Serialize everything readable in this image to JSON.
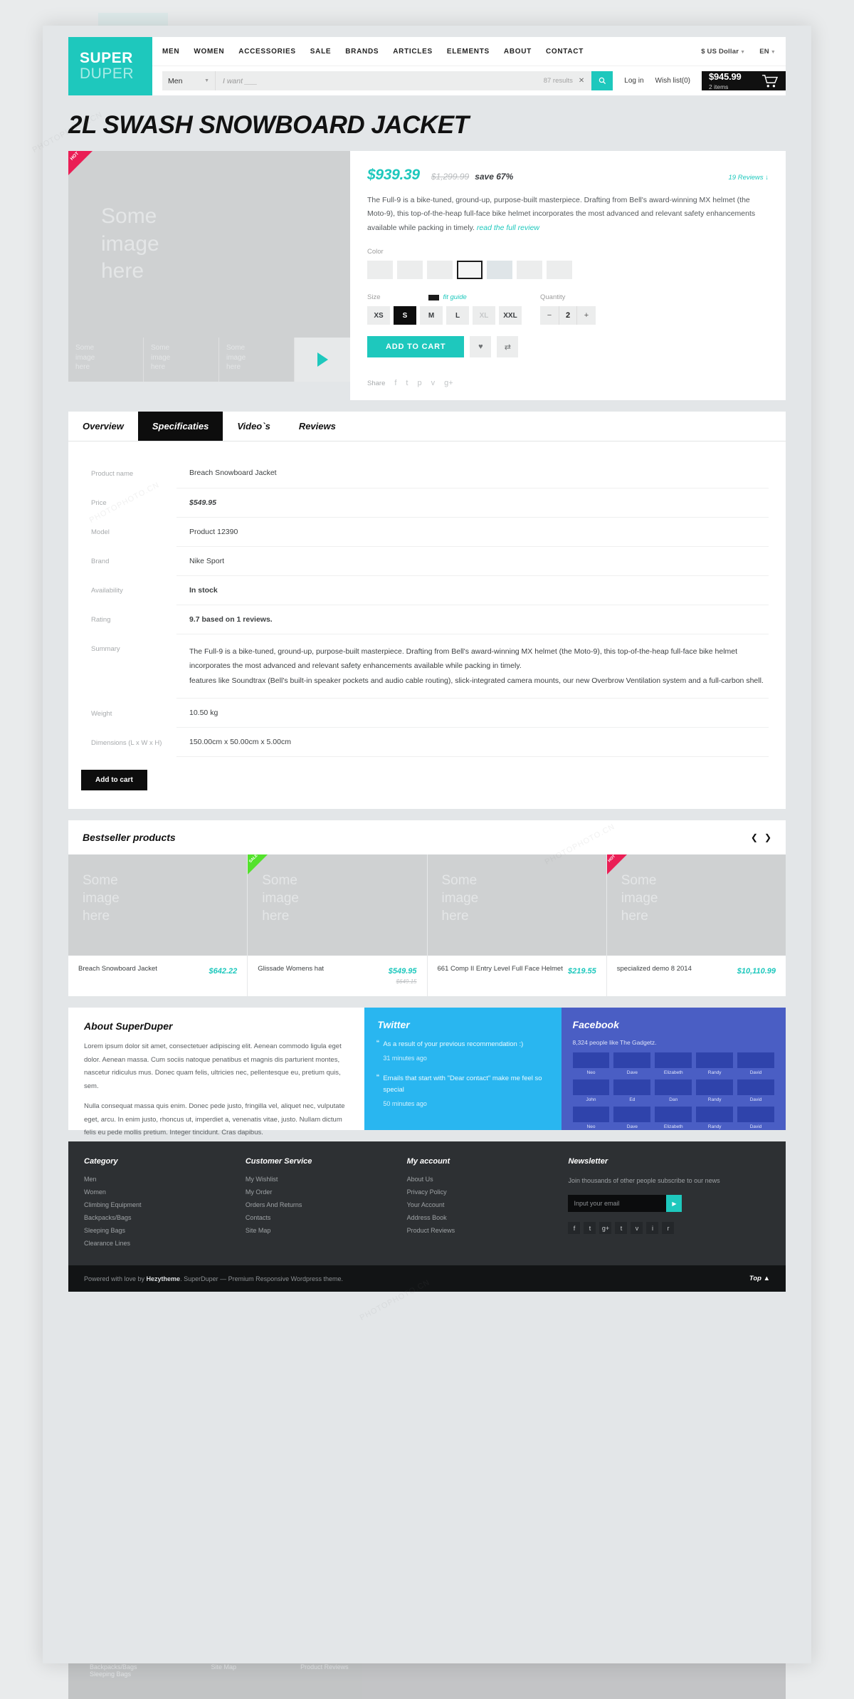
{
  "header": {
    "logo_line1": "SUPER",
    "logo_line2": "DUPER",
    "nav": [
      "MEN",
      "WOMEN",
      "ACCESSORIES",
      "SALE",
      "BRANDS",
      "ARTICLES",
      "ELEMENTS",
      "ABOUT",
      "CONTACT"
    ],
    "currency": "$ US Dollar",
    "language": "EN",
    "category_select": "Men",
    "search_placeholder": "I want ___",
    "search_results": "87 results",
    "search_clear": "✕",
    "search_icon": "search-icon",
    "login": "Log in",
    "wishlist": "Wish list(0)",
    "cart_amount": "$945.99",
    "cart_items": "2 items"
  },
  "product": {
    "title": "2L SWASH SNOWBOARD JACKET",
    "ribbon": "HOT",
    "image_placeholder": "Some image here",
    "thumb_placeholder": "Some image here",
    "price": "$939.39",
    "old_price": "$1,299.99",
    "save": "save 67%",
    "reviews_link": "19 Reviews ↓",
    "description": "The Full-9 is a bike-tuned, ground-up, purpose-built masterpiece. Drafting from Bell's award-winning MX helmet (the Moto-9), this top-of-the-heap full-face bike helmet incorporates the most advanced and relevant safety enhancements available while packing in timely.",
    "read_full_review": "read the full review",
    "color_label": "Color",
    "size_label": "Size",
    "fit_guide": "fit guide",
    "quantity_label": "Quantity",
    "sizes": [
      {
        "label": "XS",
        "state": "normal"
      },
      {
        "label": "S",
        "state": "active"
      },
      {
        "label": "M",
        "state": "normal"
      },
      {
        "label": "L",
        "state": "normal"
      },
      {
        "label": "XL",
        "state": "disabled"
      },
      {
        "label": "XXL",
        "state": "normal"
      }
    ],
    "qty_minus": "−",
    "qty_value": "2",
    "qty_plus": "+",
    "add_to_cart": "ADD TO CART",
    "wishlist_icon": "♥",
    "compare_icon": "⇄",
    "share_label": "Share",
    "share_icons": [
      "f",
      "t",
      "p",
      "v",
      "g+"
    ]
  },
  "tabs": [
    {
      "label": "Overview",
      "active": false
    },
    {
      "label": "Specificaties",
      "active": true
    },
    {
      "label": "Video`s",
      "active": false
    },
    {
      "label": "Reviews",
      "active": false
    }
  ],
  "spec": {
    "rows": [
      {
        "key": "Product name",
        "value": "Breach Snowboard Jacket",
        "style": "plain"
      },
      {
        "key": "Price",
        "value": "$549.95",
        "style": "teal"
      },
      {
        "key": "Model",
        "value": "Product 12390",
        "style": "plain"
      },
      {
        "key": "Brand",
        "value": "Nike Sport",
        "style": "plain"
      },
      {
        "key": "Availability",
        "value": "In stock",
        "style": "teal"
      },
      {
        "key": "Rating",
        "value": "9.7   based on 1 reviews.",
        "style": "rating"
      },
      {
        "key": "Summary",
        "value": "The Full-9 is a bike-tuned, ground-up, purpose-built masterpiece. Drafting from Bell's award-winning MX helmet (the Moto-9), this top-of-the-heap full-face bike helmet incorporates the most advanced and relevant safety enhancements available while packing in timely.\n features like Soundtrax (Bell's built-in speaker pockets and audio cable routing), slick-integrated camera mounts, our new Overbrow Ventilation system and a full-carbon shell.",
        "style": "summary"
      },
      {
        "key": "Weight",
        "value": "10.50 kg",
        "style": "plain"
      },
      {
        "key": "Dimensions (L x W x H)",
        "value": "150.00cm x 50.00cm x 5.00cm",
        "style": "plain"
      }
    ],
    "add_to_cart": "Add to cart"
  },
  "bestseller": {
    "title": "Bestseller products",
    "prev": "❮",
    "next": "❯",
    "image_placeholder": "Some image here",
    "items": [
      {
        "name": "Breach Snowboard Jacket",
        "price": "$642.22",
        "old_price": "",
        "badge": ""
      },
      {
        "name": "Glissade Womens hat",
        "price": "$549.95",
        "old_price": "$649.15",
        "badge": "SALE"
      },
      {
        "name": "661 Comp II Entry Level Full Face Helmet",
        "price": "$219.55",
        "old_price": "",
        "badge": ""
      },
      {
        "name": "specialized demo 8 2014",
        "price": "$10,110.99",
        "old_price": "",
        "badge": "HOT"
      }
    ]
  },
  "about": {
    "title": "About SuperDuper",
    "paragraph1": "Lorem ipsum dolor sit amet, consectetuer adipiscing elit. Aenean commodo ligula eget dolor. Aenean massa. Cum sociis natoque penatibus et magnis dis parturient montes, nascetur ridiculus mus. Donec quam felis, ultricies nec, pellentesque eu, pretium quis, sem.",
    "paragraph2": "Nulla consequat massa quis enim. Donec pede justo, fringilla vel, aliquet nec, vulputate eget, arcu. In enim justo, rhoncus ut, imperdiet a, venenatis vitae, justo. Nullam dictum felis eu pede mollis pretium. Integer tincidunt. Cras dapibus."
  },
  "twitter": {
    "title": "Twitter",
    "tweets": [
      {
        "text": "As a result of your previous recommendation :)",
        "time": "31 minutes ago"
      },
      {
        "text": "Emails that start with \"Dear contact\" make me feel so special",
        "time": "50 minutes ago"
      }
    ]
  },
  "facebook": {
    "title": "Facebook",
    "likes": "8,324 people like The Gadgetz.",
    "friends": [
      "Neo",
      "Dave",
      "Elizabeth",
      "Randy",
      "David",
      "John",
      "Ed",
      "Dan",
      "Randy",
      "David",
      "Neo",
      "Dave",
      "Elizabeth",
      "Randy",
      "David"
    ]
  },
  "footer": {
    "columns": [
      {
        "title": "Category",
        "links": [
          "Men",
          "Women",
          "Climbing Equipment",
          "Backpacks/Bags",
          "Sleeping Bags",
          "Clearance Lines"
        ]
      },
      {
        "title": "Customer Service",
        "links": [
          "My Wishlist",
          "My Order",
          "Orders And Returns",
          "Contacts",
          "Site Map"
        ]
      },
      {
        "title": "My account",
        "links": [
          "About Us",
          "Privacy Policy",
          "Your Account",
          "Address Book",
          "Product Reviews"
        ]
      }
    ],
    "newsletter": {
      "title": "Newsletter",
      "text": "Join thousands of other people subscribe to our news",
      "placeholder": "Input your email",
      "button_icon": "▶",
      "socials": [
        "f",
        "t",
        "g+",
        "t",
        "v",
        "i",
        "r"
      ]
    },
    "copyright_pre": "Powered with love by ",
    "copyright_brand": "Hezytheme",
    "copyright_post": ". SuperDuper — Premium Responsive Wordpress theme.",
    "top": "Top ▲"
  },
  "colors": {
    "accent": "#1ec8bd",
    "hot": "#ea1e55",
    "sale": "#53e22c",
    "twitter": "#29b6f0",
    "facebook": "#4a5ec4",
    "footer": "#2d3033"
  }
}
